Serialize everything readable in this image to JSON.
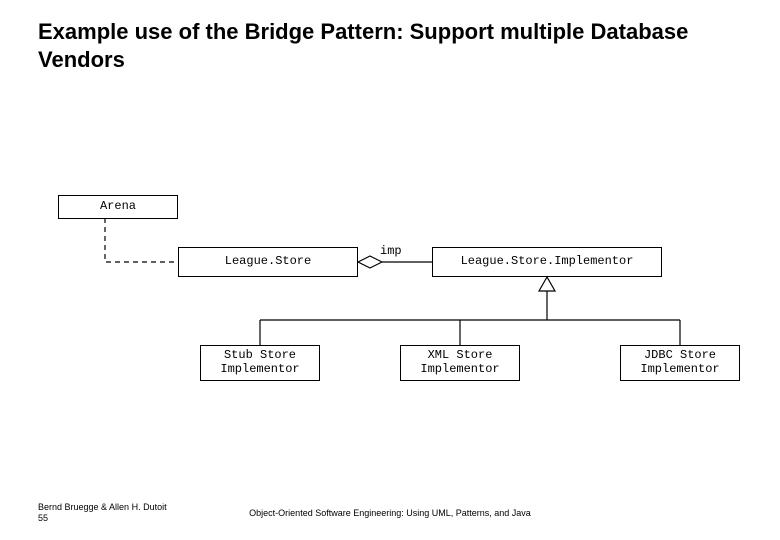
{
  "title": "Example use of the Bridge Pattern:\nSupport multiple Database Vendors",
  "boxes": {
    "arena": "Arena",
    "leagueStore": "League.Store",
    "leagueStoreImpl": "League.Store.Implementor",
    "stub": "Stub Store\nImplementor",
    "xml": "XML Store\nImplementor",
    "jdbc": "JDBC Store\nImplementor"
  },
  "labels": {
    "imp": "imp"
  },
  "footer": {
    "authors": "Bernd Bruegge & Allen H. Dutoit",
    "slide": "55",
    "bookTitle": "Object-Oriented Software Engineering: Using UML, Patterns, and Java"
  }
}
